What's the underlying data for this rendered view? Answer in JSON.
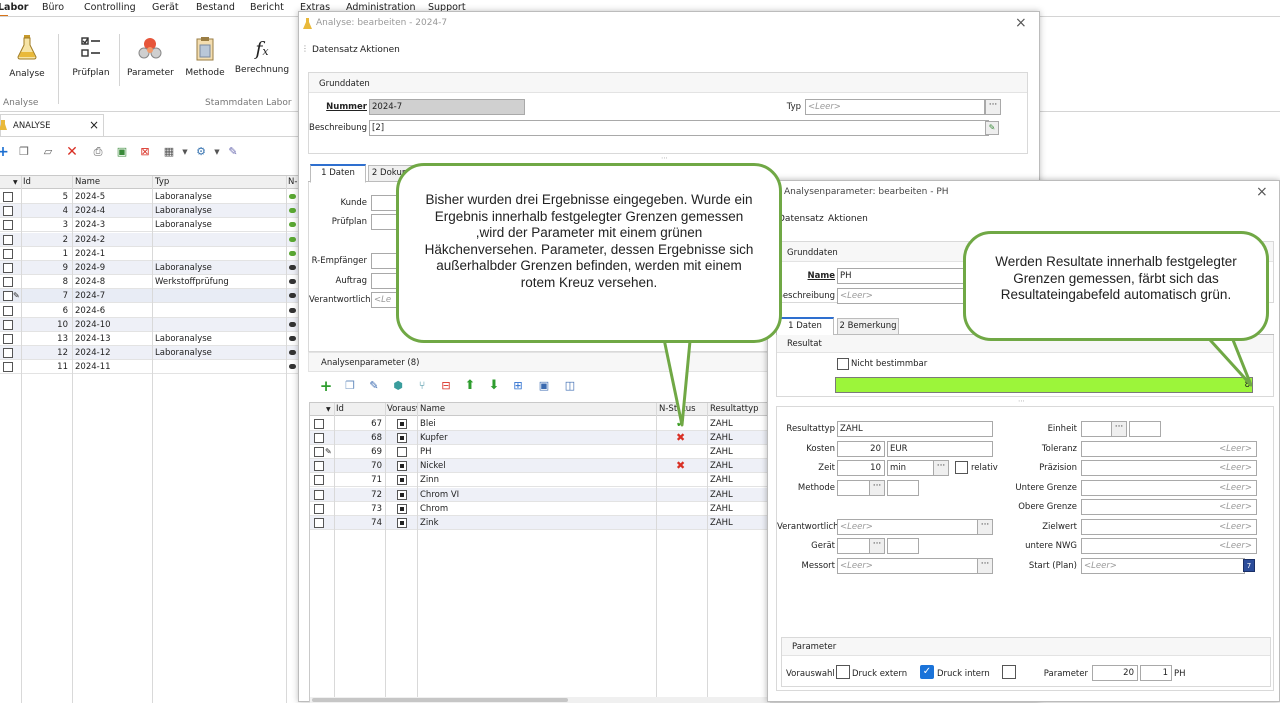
{
  "ribbon": {
    "tabs": [
      "Labor",
      "Büro",
      "Controlling",
      "Gerät",
      "Bestand",
      "Bericht",
      "Extras",
      "Administration",
      "Support"
    ],
    "buttons": [
      {
        "label": "Analyse",
        "icon": "flask-icon"
      },
      {
        "label": "Prüfplan",
        "icon": "checklist-icon"
      },
      {
        "label": "Parameter",
        "icon": "molecule-icon"
      },
      {
        "label": "Methode",
        "icon": "clipboard-icon"
      },
      {
        "label": "Berechnung",
        "icon": "function-icon"
      }
    ],
    "groups": [
      "Analyse",
      "Stammdaten Labor"
    ]
  },
  "doc_tab": {
    "label": "ANALYSE",
    "close": "×"
  },
  "list": {
    "headers": [
      "Id",
      "Name",
      "Typ",
      "N-"
    ],
    "rows": [
      {
        "id": "5",
        "name": "2024-5",
        "typ": "Laboranalyse"
      },
      {
        "id": "4",
        "name": "2024-4",
        "typ": "Laboranalyse"
      },
      {
        "id": "3",
        "name": "2024-3",
        "typ": "Laboranalyse"
      },
      {
        "id": "2",
        "name": "2024-2",
        "typ": ""
      },
      {
        "id": "1",
        "name": "2024-1",
        "typ": ""
      },
      {
        "id": "9",
        "name": "2024-9",
        "typ": "Laboranalyse"
      },
      {
        "id": "8",
        "name": "2024-8",
        "typ": "Werkstoffprüfung"
      },
      {
        "id": "7",
        "name": "2024-7",
        "typ": ""
      },
      {
        "id": "6",
        "name": "2024-6",
        "typ": ""
      },
      {
        "id": "10",
        "name": "2024-10",
        "typ": ""
      },
      {
        "id": "13",
        "name": "2024-13",
        "typ": "Laboranalyse"
      },
      {
        "id": "12",
        "name": "2024-12",
        "typ": "Laboranalyse"
      },
      {
        "id": "11",
        "name": "2024-11",
        "typ": ""
      }
    ]
  },
  "win1": {
    "title": "Analyse: bearbeiten - 2024-7",
    "menu": [
      "Datensatz",
      "Aktionen"
    ],
    "group": "Grunddaten",
    "nummer_label": "Nummer",
    "nummer_value": "2024-7",
    "typ_label": "Typ",
    "typ_placeholder": "<Leer>",
    "beschreibung_label": "Beschreibung",
    "beschreibung_value": "[2]",
    "tabs": [
      "1 Daten",
      "2 Dokument"
    ],
    "fields": [
      "Kunde",
      "Prüfplan",
      "R-Empfänger",
      "Auftrag",
      "Verantwortlich"
    ],
    "verantwortlich_placeholder": "<Le",
    "params_group": "Analysenparameter (8)",
    "grid_headers": [
      "Id",
      "Vorausw",
      "Name",
      "N-Status",
      "Resultattyp"
    ],
    "grid_rows": [
      {
        "id": "67",
        "name": "Blei",
        "status": "ok",
        "typ": "ZAHL",
        "vor": true
      },
      {
        "id": "68",
        "name": "Kupfer",
        "status": "err",
        "typ": "ZAHL",
        "vor": true
      },
      {
        "id": "69",
        "name": "PH",
        "status": "",
        "typ": "ZAHL",
        "vor": false
      },
      {
        "id": "70",
        "name": "Nickel",
        "status": "err",
        "typ": "ZAHL",
        "vor": true
      },
      {
        "id": "71",
        "name": "Zinn",
        "status": "",
        "typ": "ZAHL",
        "vor": true
      },
      {
        "id": "72",
        "name": "Chrom VI",
        "status": "",
        "typ": "ZAHL",
        "vor": true
      },
      {
        "id": "73",
        "name": "Chrom",
        "status": "",
        "typ": "ZAHL",
        "vor": true
      },
      {
        "id": "74",
        "name": "Zink",
        "status": "",
        "typ": "ZAHL",
        "vor": true
      }
    ]
  },
  "win2": {
    "title": "Analysenparameter: bearbeiten - PH",
    "menu": [
      "Datensatz",
      "Aktionen"
    ],
    "group": "Grunddaten",
    "name_label": "Name",
    "name_value": "PH",
    "beschreibung_label": "Beschreibung",
    "beschreibung_placeholder": "<Leer>",
    "tabs": [
      "1 Daten",
      "2 Bemerkung"
    ],
    "resultat_group": "Resultat",
    "nicht_bestimmbar": "Nicht bestimmbar",
    "result_value": "8",
    "left": {
      "resultattyp_label": "Resultattyp",
      "resultattyp_value": "ZAHL",
      "kosten_label": "Kosten",
      "kosten_value": "20",
      "kosten_unit": "EUR",
      "zeit_label": "Zeit",
      "zeit_value": "10",
      "zeit_unit": "min",
      "relativ": "relativ",
      "methode_label": "Methode",
      "verantwortlich_label": "Verantwortlich",
      "geraet_label": "Gerät",
      "messort_label": "Messort",
      "leer": "<Leer>"
    },
    "right": {
      "einheit": "Einheit",
      "toleranz": "Toleranz",
      "praezision": "Präzision",
      "untere_grenze": "Untere Grenze",
      "obere_grenze": "Obere Grenze",
      "zielwert": "Zielwert",
      "untere_nwg": "untere NWG",
      "start_plan": "Start (Plan)",
      "leer": "<Leer>"
    },
    "parameter_group": "Parameter",
    "vorauswahl": "Vorauswahl",
    "druck_extern": "Druck extern",
    "druck_intern": "Druck intern",
    "parameter_label": "Parameter",
    "parameter_value": "20",
    "parameter_value2": "1",
    "parameter_name": "PH"
  },
  "callout1": "Bisher wurden drei Ergebnisse eingegeben. Wurde ein Ergebnis innerhalb festgelegter Grenzen gemessen ,wird der Parameter mit einem grünen Häkchenversehen. Parameter, dessen Ergebnisse sich außerhalbder Grenzen befinden, werden mit einem rotem Kreuz versehen.",
  "callout2": "Werden Resultate innerhalb festgelegter Grenzen gemessen, färbt sich das Resultateingabefeld automatisch grün.",
  "colors": {
    "green_field": "#9cf53a",
    "callout_border": "#70a845",
    "ok": "#3a9d23",
    "err": "#d93025"
  }
}
